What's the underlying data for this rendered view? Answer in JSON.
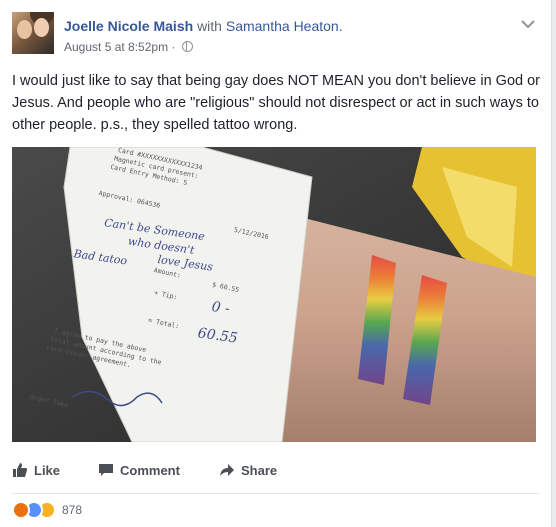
{
  "post": {
    "author": "Joelle Nicole Maish",
    "with_text": "with",
    "tagged": "Samantha Heaton.",
    "timestamp": "August 5 at 8:52pm",
    "separator": "·",
    "body": "I would just like to say that being gay does NOT MEAN you don't believe in God or Jesus. And people who are \"religious\" should not disrespect or act in such ways to other people. p.s., they spelled tattoo wrong."
  },
  "photo": {
    "receipt_lines": [
      "Card #XXXXXXXXXXXX1234",
      "Magnetic card present:",
      "Card Entry Method: S",
      "Approval: 064536",
      "Amount:",
      "+ Tip:",
      "= Total:",
      "I agree to pay the above",
      "total amount according to the",
      "card issuer agreement.",
      "Order Take"
    ],
    "handwriting": [
      "Can't be Someone",
      "who doesn't",
      "love Jesus",
      "Bad tatoo"
    ],
    "amount": "$ 60.55",
    "tip": "0 -",
    "total": "60.55",
    "time": "5/12/2016"
  },
  "actions": {
    "like": "Like",
    "comment": "Comment",
    "share": "Share"
  },
  "reactions": {
    "count": "878",
    "icons": [
      "angry-icon",
      "like-icon",
      "wow-icon"
    ]
  },
  "colors": {
    "link": "#365899",
    "angry": "#e9710f",
    "like": "#5890ff",
    "wow": "#f7b125"
  }
}
